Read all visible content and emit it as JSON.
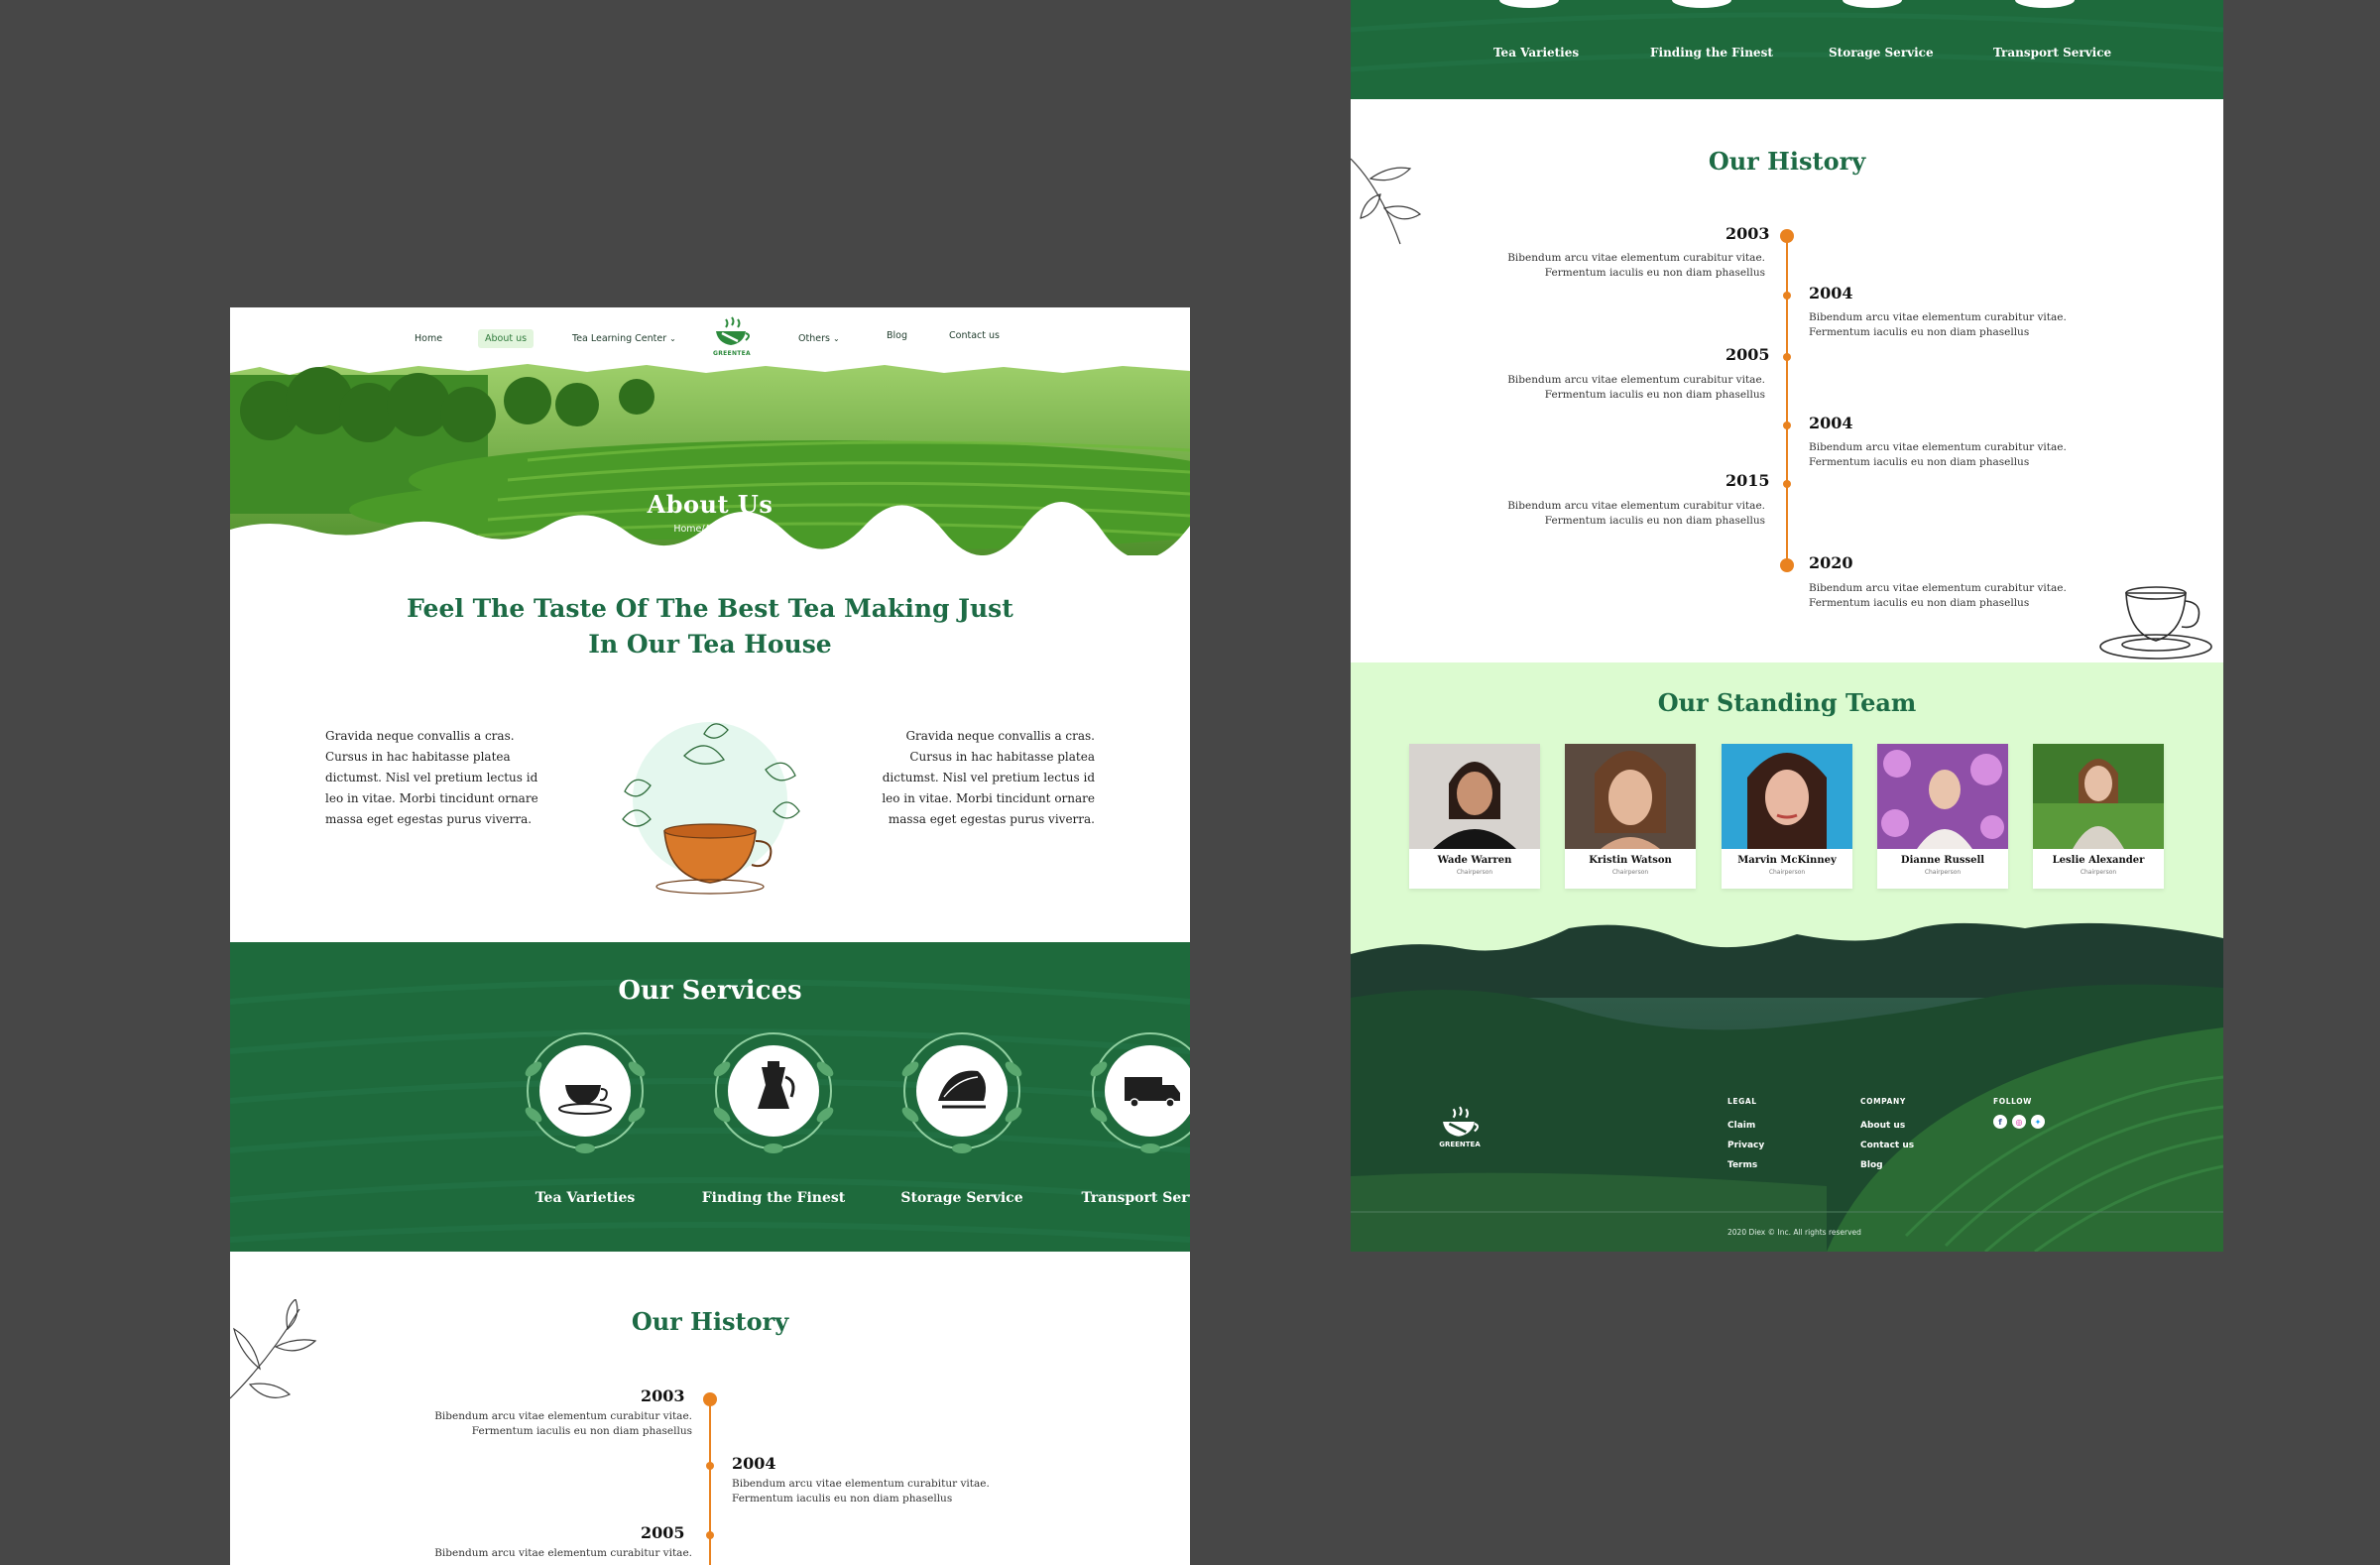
{
  "left": {
    "nav": {
      "home": "Home",
      "about": "About us",
      "tea_center": "Tea Learning Center",
      "others": "Others",
      "blog": "Blog",
      "contact": "Contact us",
      "logo_text": "GREENTEA"
    },
    "hero": {
      "title": "About  Us",
      "breadcrumb": "Home/About us"
    },
    "intro": {
      "heading_line1": "Feel The Taste Of The Best Tea Making Just",
      "heading_line2": "In Our Tea House",
      "left_text": "Gravida neque convallis a cras. Cursus in hac habitasse platea dictumst. Nisl vel pretium lectus id leo in vitae. Morbi tincidunt ornare massa eget egestas purus viverra.",
      "right_text": "Gravida neque convallis a cras. Cursus in hac habitasse platea dictumst. Nisl vel pretium lectus id leo in vitae. Morbi tincidunt ornare massa eget egestas purus viverra."
    },
    "services": {
      "title": "Our Services",
      "items": [
        {
          "label": "Tea Varieties",
          "icon": "teacup-icon"
        },
        {
          "label": "Finding the Finest",
          "icon": "teapot-icon"
        },
        {
          "label": "Storage Service",
          "icon": "tea-leaves-icon"
        },
        {
          "label": "Transport Service",
          "icon": "truck-icon"
        }
      ]
    },
    "history": {
      "title": "Our History",
      "entries": [
        {
          "year": "2003",
          "text": "Bibendum arcu vitae elementum curabitur vitae. Fermentum iaculis eu non diam phasellus"
        },
        {
          "year": "2004",
          "text": "Bibendum arcu vitae elementum curabitur vitae. Fermentum iaculis eu non diam phasellus"
        },
        {
          "year": "2005",
          "text": "Bibendum arcu vitae elementum curabitur vitae."
        }
      ]
    }
  },
  "right": {
    "services_top": [
      "Tea Varieties",
      "Finding the Finest",
      "Storage Service",
      "Transport Service"
    ],
    "history": {
      "title": "Our History",
      "entries": [
        {
          "year": "2003",
          "text": "Bibendum arcu vitae elementum curabitur vitae. Fermentum iaculis eu non diam phasellus"
        },
        {
          "year": "2004",
          "text": "Bibendum arcu vitae elementum curabitur vitae. Fermentum iaculis eu non diam phasellus"
        },
        {
          "year": "2005",
          "text": "Bibendum arcu vitae elementum curabitur vitae. Fermentum iaculis eu non diam phasellus"
        },
        {
          "year": "2004",
          "text": "Bibendum arcu vitae elementum curabitur vitae. Fermentum iaculis eu non diam phasellus"
        },
        {
          "year": "2015",
          "text": "Bibendum arcu vitae elementum curabitur vitae. Fermentum iaculis eu non diam phasellus"
        },
        {
          "year": "2020",
          "text": "Bibendum arcu vitae elementum curabitur vitae. Fermentum iaculis eu non diam phasellus"
        }
      ]
    },
    "team": {
      "title": "Our Standing Team",
      "members": [
        {
          "name": "Wade Warren",
          "role": "Chairperson"
        },
        {
          "name": "Kristin Watson",
          "role": "Chairperson"
        },
        {
          "name": "Marvin McKinney",
          "role": "Chairperson"
        },
        {
          "name": "Dianne Russell",
          "role": "Chairperson"
        },
        {
          "name": "Leslie Alexander",
          "role": "Chairperson"
        }
      ]
    },
    "footer": {
      "logo_text": "GREENTEA",
      "legal_head": "LEGAL",
      "legal_links": [
        "Claim",
        "Privacy",
        "Terms"
      ],
      "company_head": "COMPANY",
      "company_links": [
        "About us",
        "Contact us",
        "Blog"
      ],
      "follow_head": "FOLLOW",
      "social": [
        "facebook-icon",
        "instagram-icon",
        "twitter-icon"
      ],
      "copyright": "2020 Diex © Inc. All rights reserved"
    }
  },
  "colors": {
    "background": "#474747",
    "brand_green": "#1e6a3c",
    "heading_green": "#1d6b45",
    "accent_orange": "#e9821f",
    "team_bg": "#dcfbd0"
  }
}
